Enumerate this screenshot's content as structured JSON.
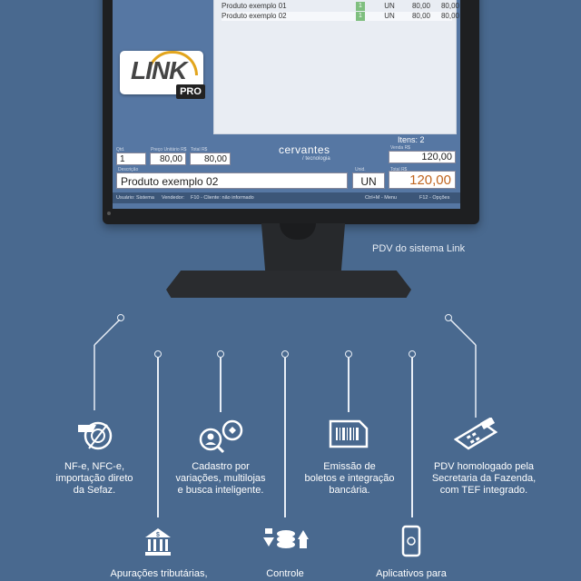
{
  "pos": {
    "products": [
      {
        "name": "Produto exemplo 01",
        "qty": "1",
        "unit": "UN",
        "unit_price": "80,00",
        "total": "80,00"
      },
      {
        "name": "Produto exemplo 02",
        "qty": "1",
        "unit": "UN",
        "unit_price": "80,00",
        "total": "80,00"
      }
    ],
    "logo_text": "LINK",
    "logo_badge": "PRO",
    "brand": "cervantes",
    "brand_sub": "/ tecnologia",
    "itens_label": "Itens: 2",
    "labels": {
      "qtd": "Qtd.",
      "preco": "Preço Unitário R$",
      "total": "Total R$",
      "venda": "Venda R$",
      "descricao": "Descrição",
      "unid": "Unid.",
      "total2": "Total R$"
    },
    "qty_value": "1",
    "price_value": "80,00",
    "total_value": "80,00",
    "venda_value": "120,00",
    "description_value": "Produto exemplo 02",
    "unit_value": "UN",
    "grand_total": "120,00",
    "status": {
      "usuario": "Usuário: Sistema",
      "vendedor": "Vendedor:",
      "cliente": "F10 - Cliente: não informado",
      "menu": "Ctrl+M - Menu",
      "opcoes": "F12 - Opções"
    }
  },
  "caption": "PDV do sistema Link",
  "features": [
    {
      "text_lines": [
        "NF-e, NFC-e,",
        "importação direto",
        "da Sefaz."
      ],
      "icon": "nfe-icon"
    },
    {
      "text_lines": [
        "Cadastro por",
        "variações, multilojas",
        "e busca inteligente."
      ],
      "icon": "search-user-icon"
    },
    {
      "text_lines": [
        "Emissão de",
        "boletos e integração",
        "bancária."
      ],
      "icon": "barcode-icon"
    },
    {
      "text_lines": [
        "PDV homologado pela",
        "Secretaria da Fazenda,",
        "com TEF integrado."
      ],
      "icon": "card-terminal-icon"
    },
    {
      "text_lines": [
        "Apurações tributárias,"
      ],
      "icon": "bank-icon"
    },
    {
      "text_lines": [
        "Controle"
      ],
      "icon": "money-flow-icon"
    },
    {
      "text_lines": [
        "Aplicativos para"
      ],
      "icon": "smartphone-icon"
    }
  ],
  "colors": {
    "background": "#49698f",
    "accent": "#e2a51d",
    "total_color": "#c0651f"
  }
}
